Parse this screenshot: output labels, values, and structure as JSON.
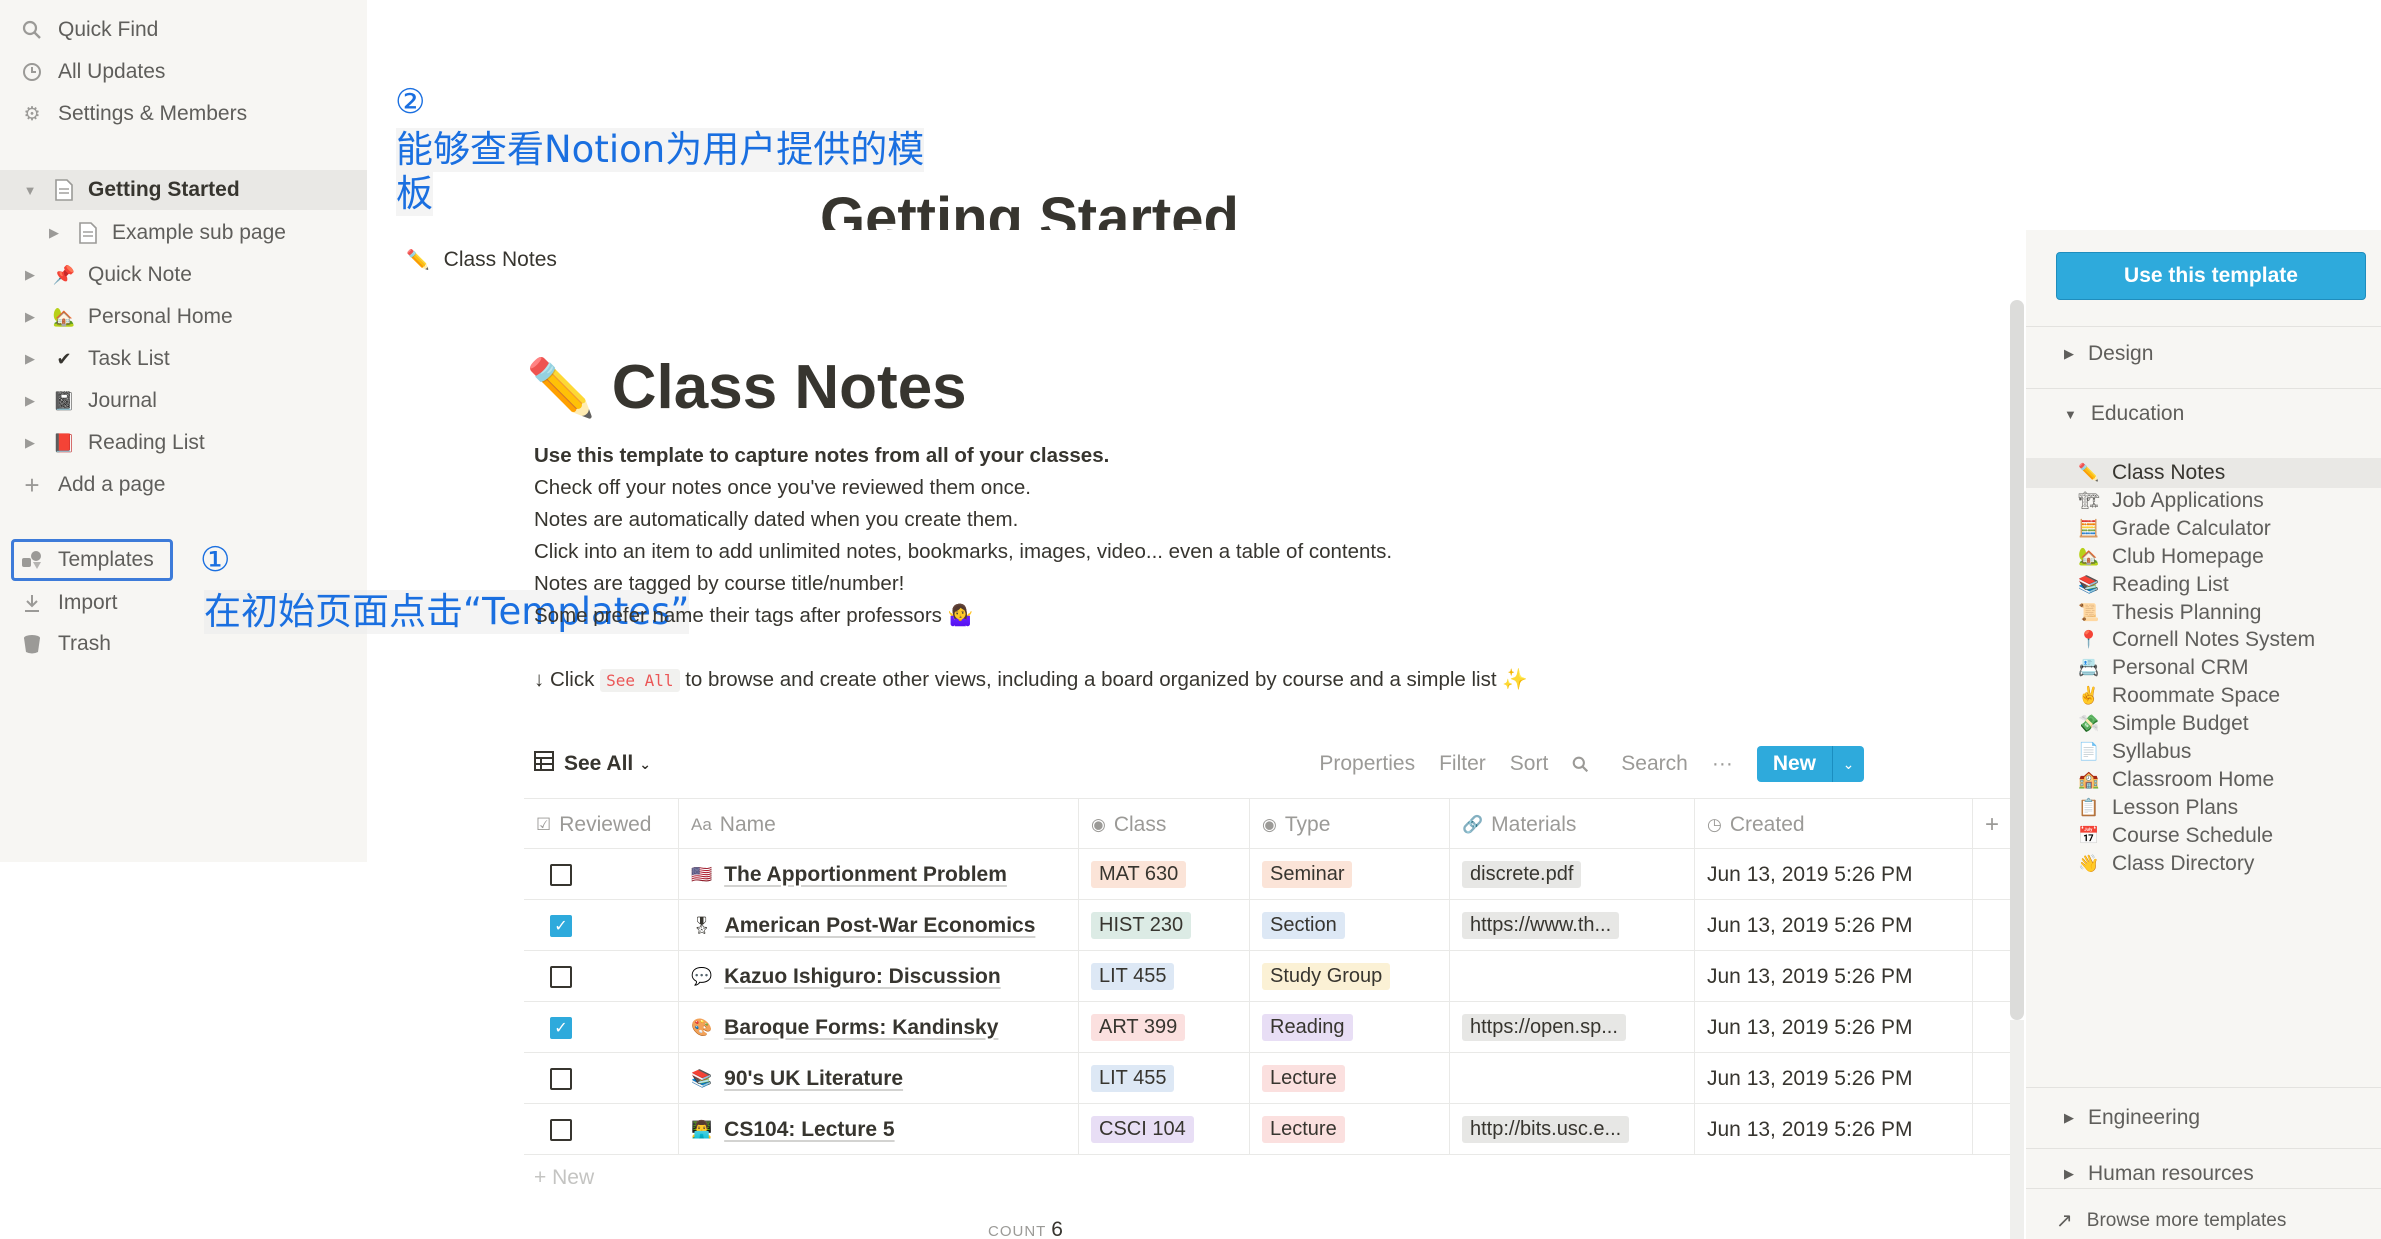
{
  "sidebar": {
    "top": [
      {
        "label": "Quick Find",
        "icon": "search-icon"
      },
      {
        "label": "All Updates",
        "icon": "clock-icon"
      },
      {
        "label": "Settings & Members",
        "icon": "gear-icon"
      }
    ],
    "pages": [
      {
        "label": "Getting Started",
        "icon": "page-icon",
        "glyph": "🗋"
      },
      {
        "label": "Example sub page",
        "icon": "page-icon",
        "glyph": "🗋"
      },
      {
        "label": "Quick Note",
        "icon": "pushpin-icon",
        "glyph": "📌"
      },
      {
        "label": "Personal Home",
        "icon": "house-icon",
        "glyph": "🏡"
      },
      {
        "label": "Task List",
        "icon": "checkmark-icon",
        "glyph": "✔"
      },
      {
        "label": "Journal",
        "icon": "journal-icon",
        "glyph": "📓"
      },
      {
        "label": "Reading List",
        "icon": "book-icon",
        "glyph": "📕"
      }
    ],
    "add_page": "Add a page",
    "bottom": [
      {
        "label": "Templates",
        "icon": "templates-icon"
      },
      {
        "label": "Import",
        "icon": "download-icon"
      },
      {
        "label": "Trash",
        "icon": "trash-icon"
      }
    ]
  },
  "annotations": {
    "step1_marker": "①",
    "step1_text": "在初始页面点击“Templates”",
    "step2_marker": "②",
    "step2_line1": "能够查看Notion为用户提供的模",
    "step2_line2": "板"
  },
  "page": {
    "title": "Getting Started"
  },
  "preview": {
    "breadcrumb": "Class Notes",
    "title": "Class Notes",
    "desc_bold": "Use this template to capture notes from all of your classes.",
    "desc_lines": [
      "Check off your notes once you've reviewed them once.",
      "Notes are automatically dated when you create them.",
      "Click into an item to add unlimited notes, bookmarks, images, video... even a table of contents.",
      "Notes are tagged by course title/number!",
      "Some prefer name their tags after professors 🤷‍♀️"
    ],
    "hint_prefix": "↓ Click",
    "hint_code": "See All",
    "hint_suffix": "to browse and create other views, including a board organized by course and a simple list ✨",
    "view_name": "See All",
    "toolbar": {
      "properties": "Properties",
      "filter": "Filter",
      "sort": "Sort",
      "search": "Search",
      "more": "···",
      "new": "New"
    },
    "columns": [
      "Reviewed",
      "Name",
      "Class",
      "Type",
      "Materials",
      "Created"
    ],
    "rows": [
      {
        "reviewed": false,
        "icon": "🇺🇸",
        "name": "The Apportionment Problem",
        "class": "MAT 630",
        "class_color": "#fbe4d8",
        "type": "Seminar",
        "type_color": "#fbe4d8",
        "materials": "discrete.pdf",
        "created": "Jun 13, 2019 5:26 PM"
      },
      {
        "reviewed": true,
        "icon": "🎖",
        "name": "American Post-War Economics",
        "class": "HIST 230",
        "class_color": "#dcebe5",
        "type": "Section",
        "type_color": "#dde8f5",
        "materials": "https://www.th...",
        "created": "Jun 13, 2019 5:26 PM"
      },
      {
        "reviewed": false,
        "icon": "💬",
        "name": "Kazuo Ishiguro: Discussion",
        "class": "LIT 455",
        "class_color": "#dde8f5",
        "type": "Study Group",
        "type_color": "#fbf1d5",
        "materials": "",
        "created": "Jun 13, 2019 5:26 PM"
      },
      {
        "reviewed": true,
        "icon": "🎨",
        "name": "Baroque Forms: Kandinsky",
        "class": "ART 399",
        "class_color": "#fbe0df",
        "type": "Reading",
        "type_color": "#e8def5",
        "materials": "https://open.sp...",
        "created": "Jun 13, 2019 5:26 PM"
      },
      {
        "reviewed": false,
        "icon": "📚",
        "name": "90's UK Literature",
        "class": "LIT 455",
        "class_color": "#dde8f5",
        "type": "Lecture",
        "type_color": "#fbe0df",
        "materials": "",
        "created": "Jun 13, 2019 5:26 PM"
      },
      {
        "reviewed": false,
        "icon": "👨‍💻",
        "name": "CS104: Lecture 5",
        "class": "CSCI 104",
        "class_color": "#e8def5",
        "type": "Lecture",
        "type_color": "#fbe0df",
        "materials": "http://bits.usc.e...",
        "created": "Jun 13, 2019 5:26 PM"
      }
    ],
    "new_row": "+ New",
    "count_label": "COUNT",
    "count_value": "6"
  },
  "template_panel": {
    "use_button": "Use this template",
    "categories": {
      "design": "Design",
      "education": "Education",
      "engineering": "Engineering",
      "hr": "Human resources"
    },
    "education_items": [
      {
        "label": "Class Notes",
        "icon": "✏️",
        "active": true
      },
      {
        "label": "Job Applications",
        "icon": "🏗"
      },
      {
        "label": "Grade Calculator",
        "icon": "🧮"
      },
      {
        "label": "Club Homepage",
        "icon": "🏡"
      },
      {
        "label": "Reading List",
        "icon": "📚"
      },
      {
        "label": "Thesis Planning",
        "icon": "📜"
      },
      {
        "label": "Cornell Notes System",
        "icon": "📍"
      },
      {
        "label": "Personal CRM",
        "icon": "📇"
      },
      {
        "label": "Roommate Space",
        "icon": "✌️"
      },
      {
        "label": "Simple Budget",
        "icon": "💸"
      },
      {
        "label": "Syllabus",
        "icon": "📄"
      },
      {
        "label": "Classroom Home",
        "icon": "🏫"
      },
      {
        "label": "Lesson Plans",
        "icon": "📋"
      },
      {
        "label": "Course Schedule",
        "icon": "📅"
      },
      {
        "label": "Class Directory",
        "icon": "👋"
      }
    ],
    "browse_more": "Browse more templates"
  }
}
